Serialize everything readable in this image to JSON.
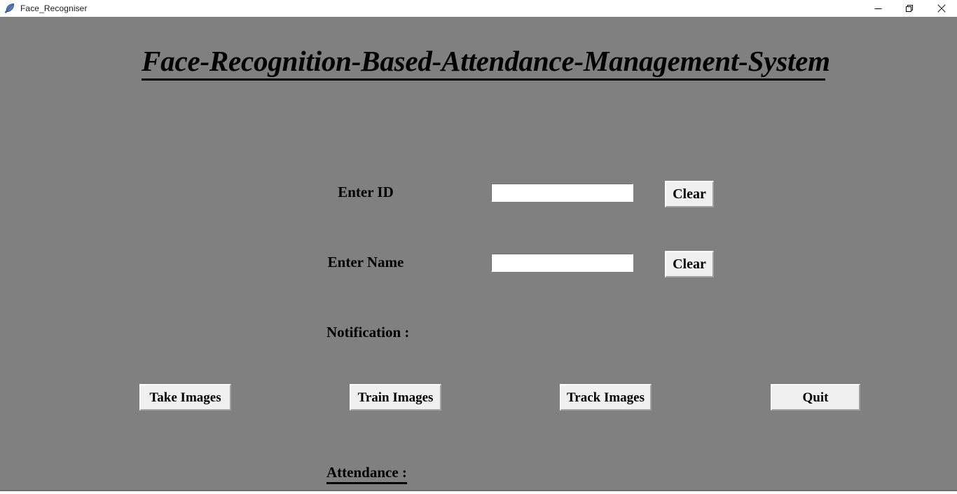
{
  "window": {
    "title": "Face_Recogniser",
    "icon": "feather-quill-icon",
    "background_color": "#808080",
    "titlebar_background": "#ffffff",
    "controls": [
      {
        "name": "minimize",
        "glyph": "minimize-icon"
      },
      {
        "name": "restore",
        "glyph": "restore-icon"
      },
      {
        "name": "close",
        "glyph": "close-icon"
      }
    ]
  },
  "heading": {
    "text": "Face-Recognition-Based-Attendance-Management-System"
  },
  "form": {
    "id_row": {
      "label": "Enter ID",
      "value": "",
      "placeholder": "",
      "clear_label": "Clear"
    },
    "name_row": {
      "label": "Enter Name",
      "value": "",
      "placeholder": "",
      "clear_label": "Clear"
    }
  },
  "notification": {
    "label": "Notification :",
    "message": ""
  },
  "actions": {
    "take_images": "Take Images",
    "train_images": "Train Images",
    "track_images": "Track Images",
    "quit": "Quit"
  },
  "attendance": {
    "label": "Attendance :",
    "entries": []
  },
  "colors": {
    "window_background": "#808080",
    "button_face": "#f0f0f0",
    "entry_background": "#ffffff",
    "text": "#000000",
    "icon_accent": "#2b4d8c"
  }
}
